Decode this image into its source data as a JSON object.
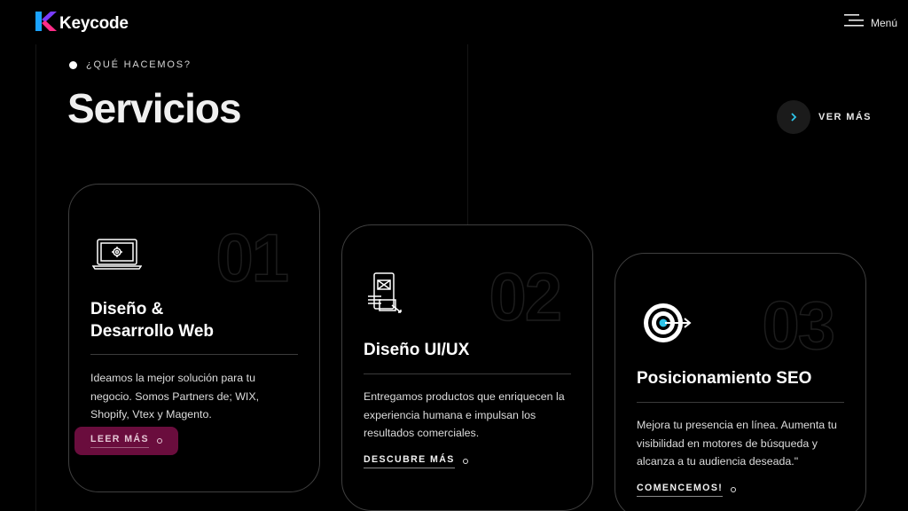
{
  "header": {
    "brand": "Keycode",
    "menu_label": "Menú",
    "logo_icon": "keycode-k-logo",
    "menu_icon": "hamburger-menu-icon"
  },
  "section": {
    "eyebrow": "¿QUÉ HACEMOS?",
    "title": "Servicios",
    "see_more": "VER MÁS"
  },
  "colors": {
    "background": "#000000",
    "card_border": "#3f3f3f",
    "accent_magenta": "#6a0d3d",
    "logo_blue": "#1aa3ff",
    "logo_pink": "#ff2d87"
  },
  "cards": [
    {
      "number": "01",
      "icon": "laptop-gear-icon",
      "title_line1": "Diseño &",
      "title_line2": "Desarrollo Web",
      "description": "Ideamos la mejor solución para tu negocio. Somos Partners de; WIX, Shopify, Vtex y Magento.",
      "cta": "LEER MÁS"
    },
    {
      "number": "02",
      "icon": "mobile-ui-design-icon",
      "title": "Diseño UI/UX",
      "description": "Entregamos productos que enriquecen la experiencia humana e impulsan los resultados comerciales.",
      "cta": "DESCUBRE MÁS"
    },
    {
      "number": "03",
      "icon": "target-arrow-icon",
      "title": "Posicionamiento SEO",
      "description": "Mejora tu presencia en línea. Aumenta tu visibilidad en motores de búsqueda y alcanza a tu audiencia deseada.\"",
      "cta": "COMENCEMOS!"
    }
  ]
}
